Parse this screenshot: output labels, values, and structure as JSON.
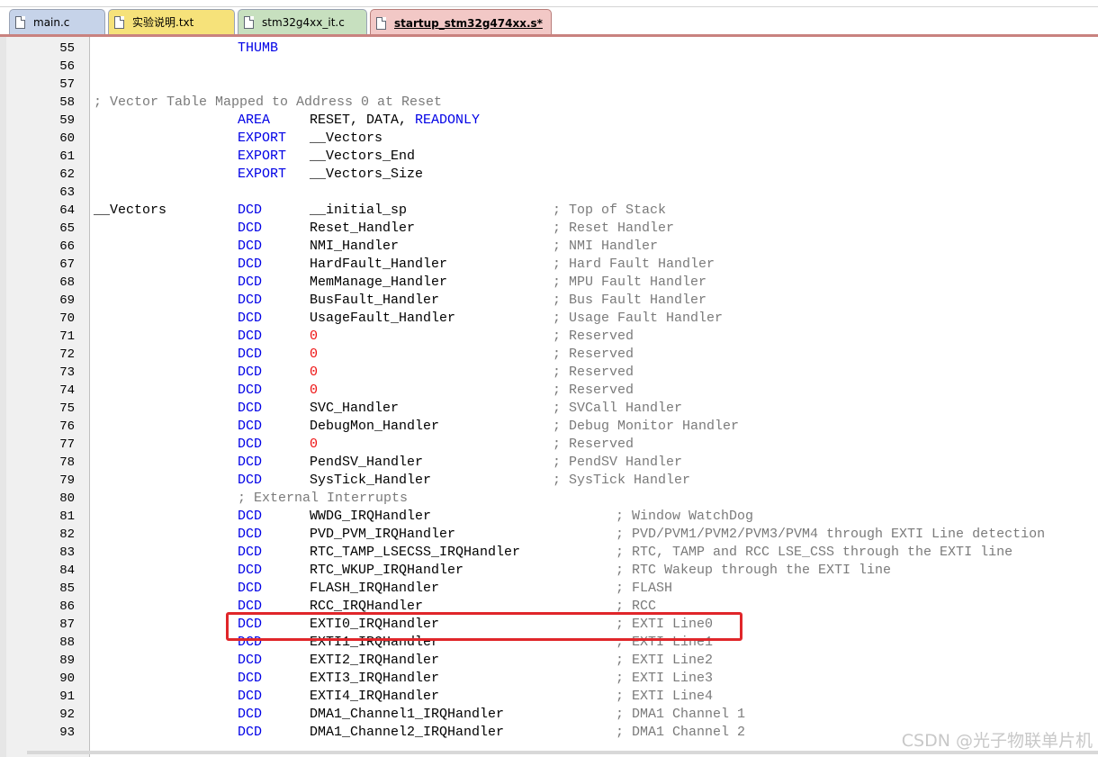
{
  "tabs": [
    {
      "label": "main.c",
      "color": "blue",
      "active": false
    },
    {
      "label": "实验说明.txt",
      "color": "yellow",
      "active": false
    },
    {
      "label": "stm32g4xx_it.c",
      "color": "green",
      "active": false
    },
    {
      "label": "startup_stm32g474xx.s*",
      "color": "pink",
      "active": true
    }
  ],
  "code_lines": [
    {
      "n": "55",
      "f1": "THUMB",
      "k1": "kw"
    },
    {
      "n": "56"
    },
    {
      "n": "57"
    },
    {
      "n": "58",
      "full": "; Vector Table Mapped to Address 0 at Reset",
      "kf": "cmt"
    },
    {
      "n": "59",
      "f1": "AREA",
      "k1": "kw",
      "f2": "RESET, DATA, ",
      "f2b": "READONLY"
    },
    {
      "n": "60",
      "f1": "EXPORT",
      "k1": "kw",
      "f2": "__Vectors"
    },
    {
      "n": "61",
      "f1": "EXPORT",
      "k1": "kw",
      "f2": "__Vectors_End"
    },
    {
      "n": "62",
      "f1": "EXPORT",
      "k1": "kw",
      "f2": "__Vectors_Size"
    },
    {
      "n": "63"
    },
    {
      "n": "64",
      "label": "__Vectors",
      "f1": "DCD",
      "k1": "kw",
      "f2": "__initial_sp",
      "f3": "; Top of Stack",
      "c3": "a"
    },
    {
      "n": "65",
      "f1": "DCD",
      "k1": "kw",
      "f2": "Reset_Handler",
      "f3": "; Reset Handler",
      "c3": "a"
    },
    {
      "n": "66",
      "f1": "DCD",
      "k1": "kw",
      "f2": "NMI_Handler",
      "f3": "; NMI Handler",
      "c3": "a"
    },
    {
      "n": "67",
      "f1": "DCD",
      "k1": "kw",
      "f2": "HardFault_Handler",
      "f3": "; Hard Fault Handler",
      "c3": "a"
    },
    {
      "n": "68",
      "f1": "DCD",
      "k1": "kw",
      "f2": "MemManage_Handler",
      "f3": "; MPU Fault Handler",
      "c3": "a"
    },
    {
      "n": "69",
      "f1": "DCD",
      "k1": "kw",
      "f2": "BusFault_Handler",
      "f3": "; Bus Fault Handler",
      "c3": "a"
    },
    {
      "n": "70",
      "f1": "DCD",
      "k1": "kw",
      "f2": "UsageFault_Handler",
      "f3": "; Usage Fault Handler",
      "c3": "a"
    },
    {
      "n": "71",
      "f1": "DCD",
      "k1": "kw",
      "f2": "0",
      "k2": "num",
      "f3": "; Reserved",
      "c3": "a"
    },
    {
      "n": "72",
      "f1": "DCD",
      "k1": "kw",
      "f2": "0",
      "k2": "num",
      "f3": "; Reserved",
      "c3": "a"
    },
    {
      "n": "73",
      "f1": "DCD",
      "k1": "kw",
      "f2": "0",
      "k2": "num",
      "f3": "; Reserved",
      "c3": "a"
    },
    {
      "n": "74",
      "f1": "DCD",
      "k1": "kw",
      "f2": "0",
      "k2": "num",
      "f3": "; Reserved",
      "c3": "a"
    },
    {
      "n": "75",
      "f1": "DCD",
      "k1": "kw",
      "f2": "SVC_Handler",
      "f3": "; SVCall Handler",
      "c3": "a"
    },
    {
      "n": "76",
      "f1": "DCD",
      "k1": "kw",
      "f2": "DebugMon_Handler",
      "f3": "; Debug Monitor Handler",
      "c3": "a"
    },
    {
      "n": "77",
      "f1": "DCD",
      "k1": "kw",
      "f2": "0",
      "k2": "num",
      "f3": "; Reserved",
      "c3": "a"
    },
    {
      "n": "78",
      "f1": "DCD",
      "k1": "kw",
      "f2": "PendSV_Handler",
      "f3": "; PendSV Handler",
      "c3": "a"
    },
    {
      "n": "79",
      "f1": "DCD",
      "k1": "kw",
      "f2": "SysTick_Handler",
      "f3": "; SysTick Handler",
      "c3": "a"
    },
    {
      "n": "80",
      "f1": "; External Interrupts",
      "k1": "cmt"
    },
    {
      "n": "81",
      "f1": "DCD",
      "k1": "kw",
      "f2": "WWDG_IRQHandler",
      "f3": "; Window WatchDog",
      "c3": "b"
    },
    {
      "n": "82",
      "f1": "DCD",
      "k1": "kw",
      "f2": "PVD_PVM_IRQHandler",
      "f3": "; PVD/PVM1/PVM2/PVM3/PVM4 through EXTI Line detection",
      "c3": "b"
    },
    {
      "n": "83",
      "f1": "DCD",
      "k1": "kw",
      "f2": "RTC_TAMP_LSECSS_IRQHandler",
      "f3": "; RTC, TAMP and RCC LSE_CSS through the EXTI line",
      "c3": "b"
    },
    {
      "n": "84",
      "f1": "DCD",
      "k1": "kw",
      "f2": "RTC_WKUP_IRQHandler",
      "f3": "; RTC Wakeup through the EXTI line",
      "c3": "b"
    },
    {
      "n": "85",
      "f1": "DCD",
      "k1": "kw",
      "f2": "FLASH_IRQHandler",
      "f3": "; FLASH",
      "c3": "b"
    },
    {
      "n": "86",
      "f1": "DCD",
      "k1": "kw",
      "f2": "RCC_IRQHandler",
      "f3": "; RCC",
      "c3": "b"
    },
    {
      "n": "87",
      "f1": "DCD",
      "k1": "kw",
      "f2": "EXTI0_IRQHandler",
      "f3": "; EXTI Line0",
      "c3": "b"
    },
    {
      "n": "88",
      "f1": "DCD",
      "k1": "kw",
      "f2": "EXTI1_IRQHandler",
      "f3": "; EXTI Line1",
      "c3": "b"
    },
    {
      "n": "89",
      "f1": "DCD",
      "k1": "kw",
      "f2": "EXTI2_IRQHandler",
      "f3": "; EXTI Line2",
      "c3": "b"
    },
    {
      "n": "90",
      "f1": "DCD",
      "k1": "kw",
      "f2": "EXTI3_IRQHandler",
      "f3": "; EXTI Line3",
      "c3": "b"
    },
    {
      "n": "91",
      "f1": "DCD",
      "k1": "kw",
      "f2": "EXTI4_IRQHandler",
      "f3": "; EXTI Line4",
      "c3": "b"
    },
    {
      "n": "92",
      "f1": "DCD",
      "k1": "kw",
      "f2": "DMA1_Channel1_IRQHandler",
      "f3": "; DMA1 Channel 1",
      "c3": "b"
    },
    {
      "n": "93",
      "f1": "DCD",
      "k1": "kw",
      "f2": "DMA1_Channel2_IRQHandler",
      "f3": "; DMA1 Channel 2",
      "c3": "b"
    }
  ],
  "highlighted_line": "87",
  "highlight_color": "#e0262a",
  "keyword_color": "#0000e6",
  "number_color": "#ee1111",
  "comment_color": "#7a7a7a",
  "watermark": "CSDN @光子物联单片机"
}
